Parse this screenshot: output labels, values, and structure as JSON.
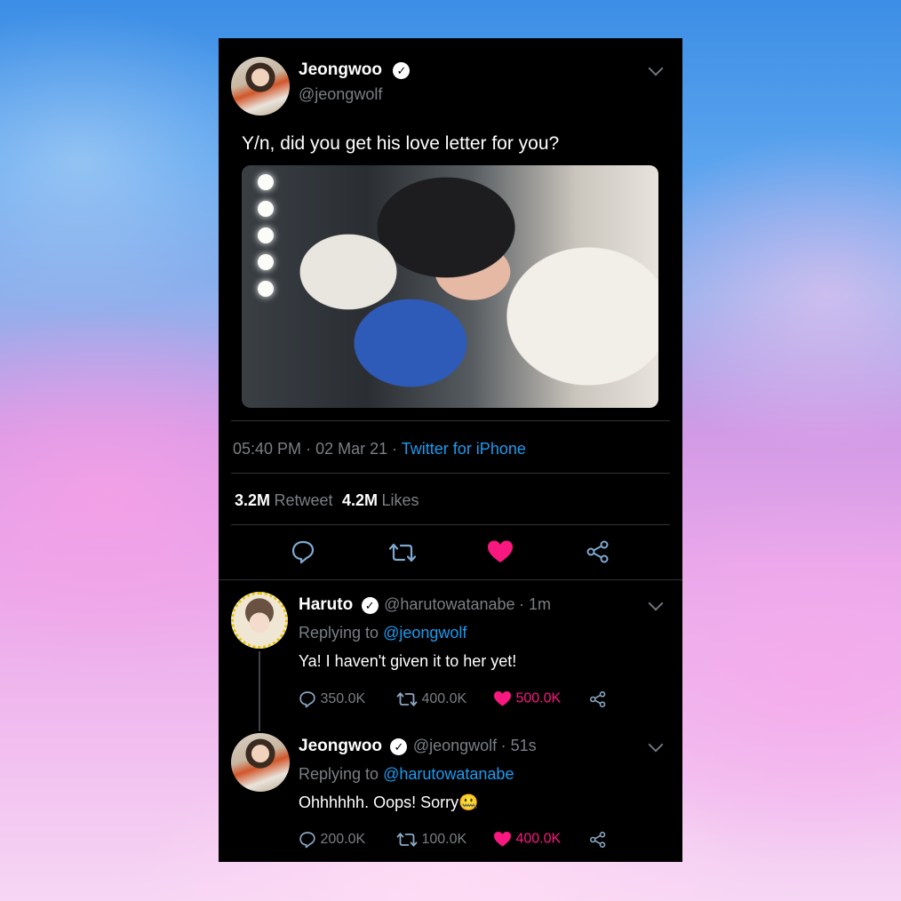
{
  "main_tweet": {
    "name": "Jeongwoo",
    "handle": "@jeongwolf",
    "text": "Y/n, did you get his love letter for you?",
    "time": "05:40 PM",
    "date": "02 Mar 21",
    "source": "Twitter for iPhone",
    "retweets": "3.2M",
    "retweets_label": "Retweet",
    "likes": "4.2M",
    "likes_label": "Likes"
  },
  "replies": [
    {
      "name": "Haruto",
      "handle": "@harutowatanabe",
      "age": "1m",
      "replying_label": "Replying to",
      "replying_to": "@jeongwolf",
      "text": "Ya! I haven't given it to her yet!",
      "reply_count": "350.0K",
      "retweet_count": "400.0K",
      "like_count": "500.0K"
    },
    {
      "name": "Jeongwoo",
      "handle": "@jeongwolf",
      "age": "51s",
      "replying_label": "Replying to",
      "replying_to": "@harutowatanabe",
      "text": "Ohhhhhh. Oops! Sorry",
      "emoji": "🤐",
      "reply_count": "200.0K",
      "retweet_count": "100.0K",
      "like_count": "400.0K"
    }
  ],
  "colors": {
    "accent": "#1d9bf0",
    "like": "#f91880",
    "card_bg": "#000000"
  },
  "icons": [
    "verified-icon",
    "chevron-down-icon",
    "reply-icon",
    "retweet-icon",
    "heart-icon",
    "share-icon"
  ]
}
